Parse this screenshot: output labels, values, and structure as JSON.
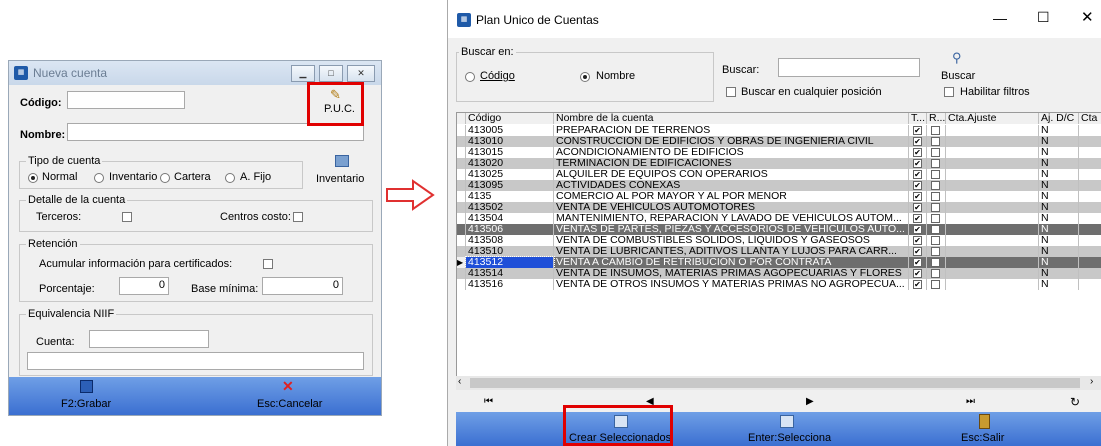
{
  "dialog": {
    "title": "Nueva cuenta",
    "codigo_label": "Código:",
    "codigo_value": "",
    "nombre_label": "Nombre:",
    "nombre_value": "",
    "puc_button": "P.U.C.",
    "tipo_cuenta": {
      "group_label": "Tipo de cuenta",
      "options": [
        "Normal",
        "Inventario",
        "Cartera",
        "A. Fijo"
      ],
      "selected": "Normal",
      "inventario_button": "Inventario"
    },
    "detalle": {
      "group_label": "Detalle de la cuenta",
      "terceros_label": "Terceros:",
      "centros_label": "Centros costo:"
    },
    "retencion": {
      "group_label": "Retención",
      "acumular_label": "Acumular información para certificados:",
      "porcentaje_label": "Porcentaje:",
      "porcentaje_value": "0",
      "base_label": "Base mínima:",
      "base_value": "0"
    },
    "niif": {
      "group_label": "Equivalencia NIIF",
      "cuenta_label": "Cuenta:",
      "cuenta_value": ""
    },
    "footer": {
      "grabar": "F2:Grabar",
      "cancelar": "Esc:Cancelar"
    }
  },
  "window": {
    "title": "Plan Unico de Cuentas",
    "buscar_en_label": "Buscar en:",
    "codigo_option": "Código",
    "nombre_option": "Nombre",
    "selected_search": "Nombre",
    "buscar_label": "Buscar:",
    "buscar_value": "",
    "buscar_cualquier": "Buscar en cualquier posición",
    "buscar_button": "Buscar",
    "habilitar_filtros": "Habilitar filtros",
    "columns": [
      "Código",
      "Nombre de la cuenta",
      "T...",
      "R...",
      "Cta.Ajuste",
      "Aj. D/C",
      "Cta"
    ],
    "rows": [
      {
        "codigo": "413005",
        "nombre": "PREPARACIÓN DE TERRENOS",
        "t": true,
        "r": false,
        "aj": "N"
      },
      {
        "codigo": "413010",
        "nombre": "CONSTRUCCIÓN DE EDIFICIOS Y OBRAS DE INGENIERIA CIVIL",
        "t": true,
        "r": false,
        "aj": "N"
      },
      {
        "codigo": "413015",
        "nombre": "ACONDICIONAMIENTO DE EDIFICIOS",
        "t": true,
        "r": false,
        "aj": "N"
      },
      {
        "codigo": "413020",
        "nombre": "TERMINACIÓN DE EDIFICACIONES",
        "t": true,
        "r": false,
        "aj": "N"
      },
      {
        "codigo": "413025",
        "nombre": "ALQUILER DE EQUIPOS CON OPERARIOS",
        "t": true,
        "r": false,
        "aj": "N"
      },
      {
        "codigo": "413095",
        "nombre": "ACTIVIDADES CONEXAS",
        "t": true,
        "r": false,
        "aj": "N"
      },
      {
        "codigo": "4135",
        "nombre": "COMERCIO AL POR MAYOR Y AL POR MENOR",
        "t": true,
        "r": false,
        "aj": "N"
      },
      {
        "codigo": "413502",
        "nombre": "VENTA DE VEHÍCULOS AUTOMOTORES",
        "t": true,
        "r": false,
        "aj": "N"
      },
      {
        "codigo": "413504",
        "nombre": "MANTENIMIENTO, REPARACIÓN Y LAVADO DE VEHÍCULOS AUTOM...",
        "t": true,
        "r": false,
        "aj": "N"
      },
      {
        "codigo": "413506",
        "nombre": "VENTAS DE PARTES, PIEZAS Y ACCESORIOS DE VEHÍCULOS AUTO...",
        "t": true,
        "r": false,
        "aj": "N"
      },
      {
        "codigo": "413508",
        "nombre": "VENTA DE COMBUSTIBLES SÓLIDOS, LÍQUIDOS Y GASEOSOS",
        "t": true,
        "r": false,
        "aj": "N"
      },
      {
        "codigo": "413510",
        "nombre": "VENTA DE LUBRICANTES, ADITIVOS LLANTA Y LUJOS PARA CARR...",
        "t": true,
        "r": false,
        "aj": "N"
      },
      {
        "codigo": "413512",
        "nombre": "VENTA A CAMBIO DE RETRIBUCIÓN O POR CONTRATA",
        "t": true,
        "r": false,
        "aj": "N"
      },
      {
        "codigo": "413514",
        "nombre": "VENTA DE INSUMOS, MATERIAS PRIMAS AGOPECUARIAS Y FLORES",
        "t": true,
        "r": false,
        "aj": "N"
      },
      {
        "codigo": "413516",
        "nombre": "VENTA DE OTROS INSUMOS Y MATERIAS PRIMAS NO AGROPECUA...",
        "t": true,
        "r": false,
        "aj": "N"
      }
    ],
    "footer": {
      "crear": "Crear Seleccionados",
      "selecciona": "Enter:Selecciona",
      "salir": "Esc:Salir"
    }
  }
}
